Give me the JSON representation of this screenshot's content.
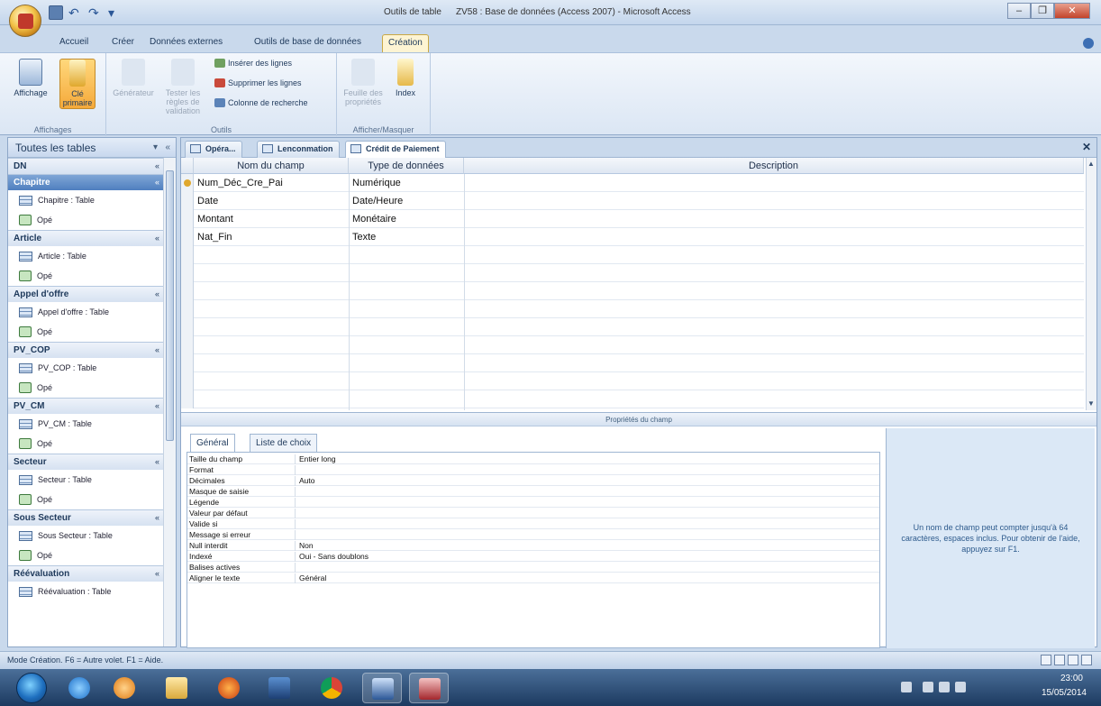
{
  "titlebar": {
    "context_title": "Outils de table",
    "window_title": "ZV58 : Base de données (Access 2007) - Microsoft Access"
  },
  "ribbon_tabs": [
    "Accueil",
    "Créer",
    "Données externes",
    "Outils de base de données",
    "Création"
  ],
  "ribbon": {
    "groups": {
      "affichages": "Affichages",
      "outils": "Outils",
      "afficher_masquer": "Afficher/Masquer"
    },
    "buttons": {
      "affichage": "Affichage",
      "cle_primaire": "Clé primaire",
      "generateur": "Générateur",
      "tester_regles": "Tester les règles de validation",
      "inserer_lignes": "Insérer des lignes",
      "supprimer_lignes": "Supprimer les lignes",
      "colonne_recherche": "Colonne de recherche",
      "feuille_proprietes": "Feuille des propriétés",
      "index": "Index"
    }
  },
  "nav": {
    "header": "Toutes les tables",
    "groups": [
      {
        "name": "DN",
        "items": []
      },
      {
        "name": "Chapitre",
        "selected": true,
        "items": [
          {
            "label": "Chapitre : Table",
            "type": "table"
          },
          {
            "label": "Opé",
            "type": "query"
          }
        ]
      },
      {
        "name": "Article",
        "items": [
          {
            "label": "Article : Table",
            "type": "table"
          },
          {
            "label": "Opé",
            "type": "query"
          }
        ]
      },
      {
        "name": "Appel d'offre",
        "items": [
          {
            "label": "Appel d'offre : Table",
            "type": "table"
          },
          {
            "label": "Opé",
            "type": "query"
          }
        ]
      },
      {
        "name": "PV_COP",
        "items": [
          {
            "label": "PV_COP : Table",
            "type": "table"
          },
          {
            "label": "Opé",
            "type": "query"
          }
        ]
      },
      {
        "name": "PV_CM",
        "items": [
          {
            "label": "PV_CM : Table",
            "type": "table"
          },
          {
            "label": "Opé",
            "type": "query"
          }
        ]
      },
      {
        "name": "Secteur",
        "items": [
          {
            "label": "Secteur : Table",
            "type": "table"
          },
          {
            "label": "Opé",
            "type": "query"
          }
        ]
      },
      {
        "name": "Sous Secteur",
        "items": [
          {
            "label": "Sous Secteur : Table",
            "type": "table"
          },
          {
            "label": "Opé",
            "type": "query"
          }
        ]
      },
      {
        "name": "Réévaluation",
        "items": [
          {
            "label": "Réévaluation : Table",
            "type": "table"
          }
        ]
      }
    ]
  },
  "doc_tabs": [
    "Opéra...",
    "Lenconmation",
    "Crédit de Paiement"
  ],
  "grid": {
    "headers": {
      "field": "Nom du champ",
      "type": "Type de données",
      "desc": "Description"
    },
    "rows": [
      {
        "field": "Num_Déc_Cre_Pai",
        "type": "Numérique",
        "key": true
      },
      {
        "field": "Date",
        "type": "Date/Heure",
        "key": false
      },
      {
        "field": "Montant",
        "type": "Monétaire",
        "key": false
      },
      {
        "field": "Nat_Fin",
        "type": "Texte",
        "key": false
      }
    ]
  },
  "properties": {
    "title": "Propriétés du champ",
    "tabs": [
      "Général",
      "Liste de choix"
    ],
    "rows": [
      {
        "name": "Taille du champ",
        "value": "Entier long"
      },
      {
        "name": "Format",
        "value": ""
      },
      {
        "name": "Décimales",
        "value": "Auto"
      },
      {
        "name": "Masque de saisie",
        "value": ""
      },
      {
        "name": "Légende",
        "value": ""
      },
      {
        "name": "Valeur par défaut",
        "value": ""
      },
      {
        "name": "Valide si",
        "value": ""
      },
      {
        "name": "Message si erreur",
        "value": ""
      },
      {
        "name": "Null interdit",
        "value": "Non"
      },
      {
        "name": "Indexé",
        "value": "Oui - Sans doublons"
      },
      {
        "name": "Balises actives",
        "value": ""
      },
      {
        "name": "Aligner le texte",
        "value": "Général"
      }
    ],
    "help": "Un nom de champ peut compter jusqu'à 64 caractères, espaces inclus. Pour obtenir de l'aide, appuyez sur F1."
  },
  "statusbar": "Mode Création. F6 = Autre volet. F1 = Aide.",
  "taskbar": {
    "time": "23:00",
    "date": "15/05/2014"
  },
  "colors": {
    "accent": "#4f7fbf",
    "ribbon_active": "#f5a93a",
    "taskbar": "#1c3a60"
  }
}
